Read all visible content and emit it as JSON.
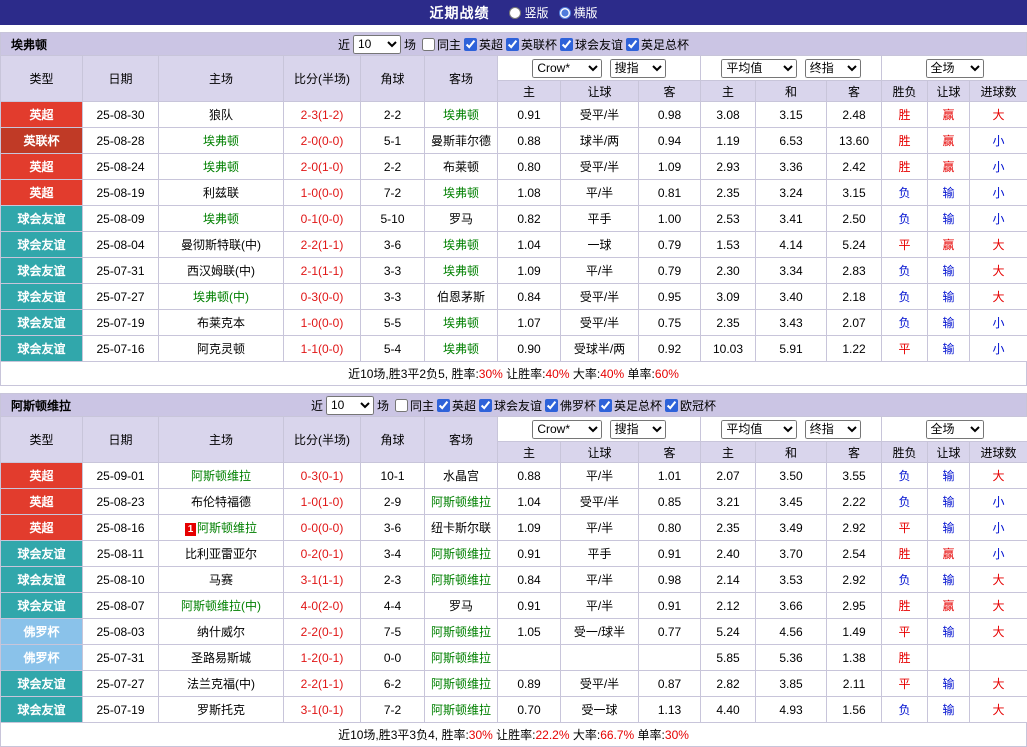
{
  "topbar": {
    "title": "近期战绩",
    "options": [
      {
        "label": "竖版",
        "selected": false
      },
      {
        "label": "横版",
        "selected": true
      }
    ]
  },
  "labels": {
    "near": "近",
    "games": "场"
  },
  "controls": {
    "count": "10",
    "company": "Crow*",
    "search": "搜指",
    "average": "平均值",
    "final": "终指",
    "scope": "全场"
  },
  "columns": {
    "c0": "类型",
    "c1": "日期",
    "c2": "主场",
    "c3": "比分(半场)",
    "c4": "角球",
    "c5": "客场",
    "s0": "主",
    "s1": "让球",
    "s2": "客",
    "s3": "主",
    "s4": "和",
    "s5": "客",
    "s6": "胜负",
    "s7": "让球",
    "s8": "进球数"
  },
  "type_colors": {
    "英超": "#e23c2d",
    "英联杯": "#c03a26",
    "球会友谊": "#31a7ab",
    "佛罗杯": "#8ac2ea"
  },
  "colors": {
    "nav_bg": "#2c2b8a",
    "section_bar_bg": "#cbc5e4",
    "header_bg": "#d9d5ec",
    "win_red": "#e60000",
    "lose_blue": "#0010d0",
    "focus_green": "#008000",
    "score_red": "#e01515"
  },
  "sections": [
    {
      "team": "埃弗顿",
      "filters": [
        {
          "label": "同主",
          "checked": false
        },
        {
          "label": "英超",
          "checked": true
        },
        {
          "label": "英联杯",
          "checked": true
        },
        {
          "label": "球会友谊",
          "checked": true
        },
        {
          "label": "英足总杯",
          "checked": true
        }
      ],
      "rows": [
        {
          "competition": "英超",
          "date": "25-08-30",
          "home": "狼队",
          "home_focus": false,
          "red_cards": "",
          "score": "2-3(1-2)",
          "corners": "2-2",
          "away": "埃弗顿",
          "away_focus": true,
          "odds_home": "0.91",
          "line": "受平/半",
          "odds_away": "0.98",
          "avg_home": "3.08",
          "avg_draw": "3.15",
          "avg_away": "2.48",
          "result": "胜",
          "handicap_result": "赢",
          "goals_result": "大"
        },
        {
          "competition": "英联杯",
          "date": "25-08-28",
          "home": "埃弗顿",
          "home_focus": true,
          "red_cards": "",
          "score": "2-0(0-0)",
          "corners": "5-1",
          "away": "曼斯菲尔德",
          "away_focus": false,
          "odds_home": "0.88",
          "line": "球半/两",
          "odds_away": "0.94",
          "avg_home": "1.19",
          "avg_draw": "6.53",
          "avg_away": "13.60",
          "result": "胜",
          "handicap_result": "赢",
          "goals_result": "小"
        },
        {
          "competition": "英超",
          "date": "25-08-24",
          "home": "埃弗顿",
          "home_focus": true,
          "red_cards": "",
          "score": "2-0(1-0)",
          "corners": "2-2",
          "away": "布莱顿",
          "away_focus": false,
          "odds_home": "0.80",
          "line": "受平/半",
          "odds_away": "1.09",
          "avg_home": "2.93",
          "avg_draw": "3.36",
          "avg_away": "2.42",
          "result": "胜",
          "handicap_result": "赢",
          "goals_result": "小"
        },
        {
          "competition": "英超",
          "date": "25-08-19",
          "home": "利兹联",
          "home_focus": false,
          "red_cards": "",
          "score": "1-0(0-0)",
          "corners": "7-2",
          "away": "埃弗顿",
          "away_focus": true,
          "odds_home": "1.08",
          "line": "平/半",
          "odds_away": "0.81",
          "avg_home": "2.35",
          "avg_draw": "3.24",
          "avg_away": "3.15",
          "result": "负",
          "handicap_result": "输",
          "goals_result": "小"
        },
        {
          "competition": "球会友谊",
          "date": "25-08-09",
          "home": "埃弗顿",
          "home_focus": true,
          "red_cards": "",
          "score": "0-1(0-0)",
          "corners": "5-10",
          "away": "罗马",
          "away_focus": false,
          "odds_home": "0.82",
          "line": "平手",
          "odds_away": "1.00",
          "avg_home": "2.53",
          "avg_draw": "3.41",
          "avg_away": "2.50",
          "result": "负",
          "handicap_result": "输",
          "goals_result": "小"
        },
        {
          "competition": "球会友谊",
          "date": "25-08-04",
          "home": "曼彻斯特联(中)",
          "home_focus": false,
          "red_cards": "",
          "score": "2-2(1-1)",
          "corners": "3-6",
          "away": "埃弗顿",
          "away_focus": true,
          "odds_home": "1.04",
          "line": "一球",
          "odds_away": "0.79",
          "avg_home": "1.53",
          "avg_draw": "4.14",
          "avg_away": "5.24",
          "result": "平",
          "handicap_result": "赢",
          "goals_result": "大"
        },
        {
          "competition": "球会友谊",
          "date": "25-07-31",
          "home": "西汉姆联(中)",
          "home_focus": false,
          "red_cards": "",
          "score": "2-1(1-1)",
          "corners": "3-3",
          "away": "埃弗顿",
          "away_focus": true,
          "odds_home": "1.09",
          "line": "平/半",
          "odds_away": "0.79",
          "avg_home": "2.30",
          "avg_draw": "3.34",
          "avg_away": "2.83",
          "result": "负",
          "handicap_result": "输",
          "goals_result": "大"
        },
        {
          "competition": "球会友谊",
          "date": "25-07-27",
          "home": "埃弗顿(中)",
          "home_focus": true,
          "red_cards": "",
          "score": "0-3(0-0)",
          "corners": "3-3",
          "away": "伯恩茅斯",
          "away_focus": false,
          "odds_home": "0.84",
          "line": "受平/半",
          "odds_away": "0.95",
          "avg_home": "3.09",
          "avg_draw": "3.40",
          "avg_away": "2.18",
          "result": "负",
          "handicap_result": "输",
          "goals_result": "大"
        },
        {
          "competition": "球会友谊",
          "date": "25-07-19",
          "home": "布莱克本",
          "home_focus": false,
          "red_cards": "",
          "score": "1-0(0-0)",
          "corners": "5-5",
          "away": "埃弗顿",
          "away_focus": true,
          "odds_home": "1.07",
          "line": "受平/半",
          "odds_away": "0.75",
          "avg_home": "2.35",
          "avg_draw": "3.43",
          "avg_away": "2.07",
          "result": "负",
          "handicap_result": "输",
          "goals_result": "小"
        },
        {
          "competition": "球会友谊",
          "date": "25-07-16",
          "home": "阿克灵顿",
          "home_focus": false,
          "red_cards": "",
          "score": "1-1(0-0)",
          "corners": "5-4",
          "away": "埃弗顿",
          "away_focus": true,
          "odds_home": "0.90",
          "line": "受球半/两",
          "odds_away": "0.92",
          "avg_home": "10.03",
          "avg_draw": "5.91",
          "avg_away": "1.22",
          "result": "平",
          "handicap_result": "输",
          "goals_result": "小"
        }
      ],
      "summary": [
        {
          "text": "近10场,胜3平2负5, ",
          "red": false
        },
        {
          "text": "胜率:",
          "red": false
        },
        {
          "text": "30%",
          "red": true
        },
        {
          "text": " 让胜率:",
          "red": false
        },
        {
          "text": "40%",
          "red": true
        },
        {
          "text": " 大率:",
          "red": false
        },
        {
          "text": "40%",
          "red": true
        },
        {
          "text": " 单率:",
          "red": false
        },
        {
          "text": "60%",
          "red": true
        }
      ]
    },
    {
      "team": "阿斯顿维拉",
      "filters": [
        {
          "label": "同主",
          "checked": false
        },
        {
          "label": "英超",
          "checked": true
        },
        {
          "label": "球会友谊",
          "checked": true
        },
        {
          "label": "佛罗杯",
          "checked": true
        },
        {
          "label": "英足总杯",
          "checked": true
        },
        {
          "label": "欧冠杯",
          "checked": true
        }
      ],
      "rows": [
        {
          "competition": "英超",
          "date": "25-09-01",
          "home": "阿斯顿维拉",
          "home_focus": true,
          "red_cards": "",
          "score": "0-3(0-1)",
          "corners": "10-1",
          "away": "水晶宫",
          "away_focus": false,
          "odds_home": "0.88",
          "line": "平/半",
          "odds_away": "1.01",
          "avg_home": "2.07",
          "avg_draw": "3.50",
          "avg_away": "3.55",
          "result": "负",
          "handicap_result": "输",
          "goals_result": "大"
        },
        {
          "competition": "英超",
          "date": "25-08-23",
          "home": "布伦特福德",
          "home_focus": false,
          "red_cards": "",
          "score": "1-0(1-0)",
          "corners": "2-9",
          "away": "阿斯顿维拉",
          "away_focus": true,
          "odds_home": "1.04",
          "line": "受平/半",
          "odds_away": "0.85",
          "avg_home": "3.21",
          "avg_draw": "3.45",
          "avg_away": "2.22",
          "result": "负",
          "handicap_result": "输",
          "goals_result": "小"
        },
        {
          "competition": "英超",
          "date": "25-08-16",
          "home": "阿斯顿维拉",
          "home_focus": true,
          "red_cards": "1",
          "score": "0-0(0-0)",
          "corners": "3-6",
          "away": "纽卡斯尔联",
          "away_focus": false,
          "odds_home": "1.09",
          "line": "平/半",
          "odds_away": "0.80",
          "avg_home": "2.35",
          "avg_draw": "3.49",
          "avg_away": "2.92",
          "result": "平",
          "handicap_result": "输",
          "goals_result": "小"
        },
        {
          "competition": "球会友谊",
          "date": "25-08-11",
          "home": "比利亚雷亚尔",
          "home_focus": false,
          "red_cards": "",
          "score": "0-2(0-1)",
          "corners": "3-4",
          "away": "阿斯顿维拉",
          "away_focus": true,
          "odds_home": "0.91",
          "line": "平手",
          "odds_away": "0.91",
          "avg_home": "2.40",
          "avg_draw": "3.70",
          "avg_away": "2.54",
          "result": "胜",
          "handicap_result": "赢",
          "goals_result": "小"
        },
        {
          "competition": "球会友谊",
          "date": "25-08-10",
          "home": "马赛",
          "home_focus": false,
          "red_cards": "",
          "score": "3-1(1-1)",
          "corners": "2-3",
          "away": "阿斯顿维拉",
          "away_focus": true,
          "odds_home": "0.84",
          "line": "平/半",
          "odds_away": "0.98",
          "avg_home": "2.14",
          "avg_draw": "3.53",
          "avg_away": "2.92",
          "result": "负",
          "handicap_result": "输",
          "goals_result": "大"
        },
        {
          "competition": "球会友谊",
          "date": "25-08-07",
          "home": "阿斯顿维拉(中)",
          "home_focus": true,
          "red_cards": "",
          "score": "4-0(2-0)",
          "corners": "4-4",
          "away": "罗马",
          "away_focus": false,
          "odds_home": "0.91",
          "line": "平/半",
          "odds_away": "0.91",
          "avg_home": "2.12",
          "avg_draw": "3.66",
          "avg_away": "2.95",
          "result": "胜",
          "handicap_result": "赢",
          "goals_result": "大"
        },
        {
          "competition": "佛罗杯",
          "date": "25-08-03",
          "home": "纳什威尔",
          "home_focus": false,
          "red_cards": "",
          "score": "2-2(0-1)",
          "corners": "7-5",
          "away": "阿斯顿维拉",
          "away_focus": true,
          "odds_home": "1.05",
          "line": "受一/球半",
          "odds_away": "0.77",
          "avg_home": "5.24",
          "avg_draw": "4.56",
          "avg_away": "1.49",
          "result": "平",
          "handicap_result": "输",
          "goals_result": "大"
        },
        {
          "competition": "佛罗杯",
          "date": "25-07-31",
          "home": "圣路易斯城",
          "home_focus": false,
          "red_cards": "",
          "score": "1-2(0-1)",
          "corners": "0-0",
          "away": "阿斯顿维拉",
          "away_focus": true,
          "odds_home": "",
          "line": "",
          "odds_away": "",
          "avg_home": "5.85",
          "avg_draw": "5.36",
          "avg_away": "1.38",
          "result": "胜",
          "handicap_result": "",
          "goals_result": ""
        },
        {
          "competition": "球会友谊",
          "date": "25-07-27",
          "home": "法兰克福(中)",
          "home_focus": false,
          "red_cards": "",
          "score": "2-2(1-1)",
          "corners": "6-2",
          "away": "阿斯顿维拉",
          "away_focus": true,
          "odds_home": "0.89",
          "line": "受平/半",
          "odds_away": "0.87",
          "avg_home": "2.82",
          "avg_draw": "3.85",
          "avg_away": "2.11",
          "result": "平",
          "handicap_result": "输",
          "goals_result": "大"
        },
        {
          "competition": "球会友谊",
          "date": "25-07-19",
          "home": "罗斯托克",
          "home_focus": false,
          "red_cards": "",
          "score": "3-1(0-1)",
          "corners": "7-2",
          "away": "阿斯顿维拉",
          "away_focus": true,
          "odds_home": "0.70",
          "line": "受一球",
          "odds_away": "1.13",
          "avg_home": "4.40",
          "avg_draw": "4.93",
          "avg_away": "1.56",
          "result": "负",
          "handicap_result": "输",
          "goals_result": "大"
        }
      ],
      "summary": [
        {
          "text": "近10场,胜3平3负4, ",
          "red": false
        },
        {
          "text": "胜率:",
          "red": false
        },
        {
          "text": "30%",
          "red": true
        },
        {
          "text": " 让胜率:",
          "red": false
        },
        {
          "text": "22.2%",
          "red": true
        },
        {
          "text": " 大率:",
          "red": false
        },
        {
          "text": "66.7%",
          "red": true
        },
        {
          "text": " 单率:",
          "red": false
        },
        {
          "text": "30%",
          "red": true
        }
      ]
    }
  ]
}
